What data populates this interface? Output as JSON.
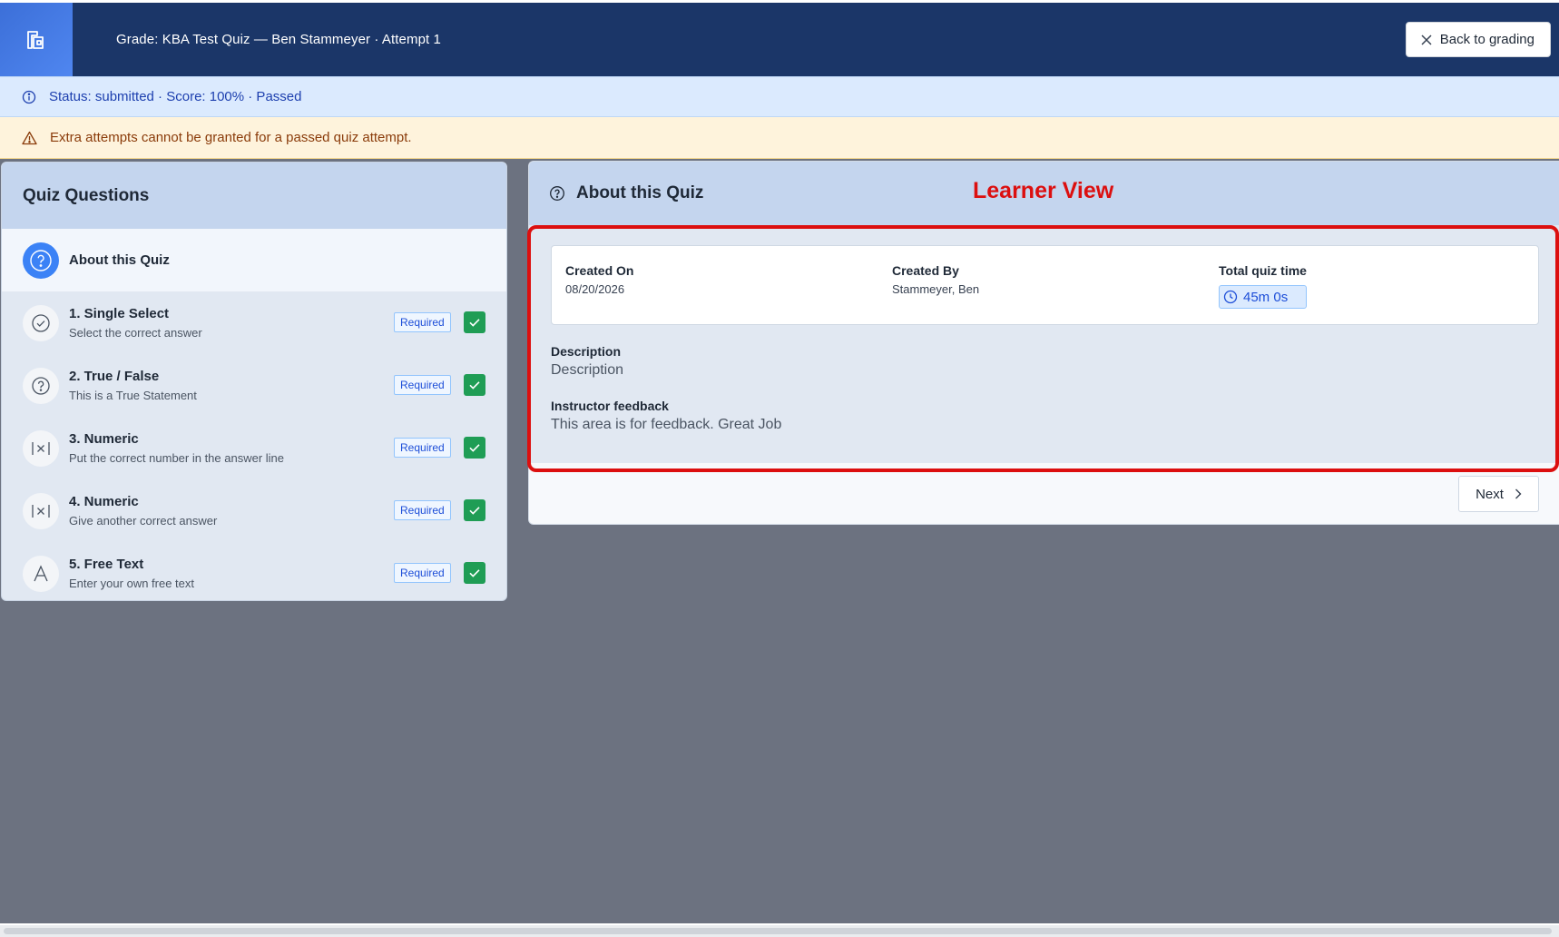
{
  "header": {
    "title": "Grade: KBA Test Quiz — Ben Stammeyer · Attempt 1",
    "back_label": "Back to grading"
  },
  "status": {
    "text": "Status: submitted · Score: 100% · Passed"
  },
  "warning": {
    "text": "Extra attempts cannot be granted for a passed quiz attempt."
  },
  "sidebar": {
    "title": "Quiz Questions",
    "about_label": "About this Quiz",
    "required_label": "Required",
    "questions": [
      {
        "title": "1. Single Select",
        "subtitle": "Select the correct answer",
        "icon": "check-circle-icon"
      },
      {
        "title": "2. True / False",
        "subtitle": "This is a True Statement",
        "icon": "question-circle-icon"
      },
      {
        "title": "3. Numeric",
        "subtitle": "Put the correct number in the answer line",
        "icon": "numeric-icon"
      },
      {
        "title": "4. Numeric",
        "subtitle": "Give another correct answer",
        "icon": "numeric-icon"
      },
      {
        "title": "5. Free Text",
        "subtitle": "Enter your own free text",
        "icon": "text-icon"
      }
    ]
  },
  "main": {
    "title": "About this Quiz",
    "annotation": "Learner View",
    "created_on_label": "Created On",
    "created_on_value": "08/20/2026",
    "created_by_label": "Created By",
    "created_by_value": "Stammeyer, Ben",
    "total_time_label": "Total quiz time",
    "total_time_value": "45m 0s",
    "description_label": "Description",
    "description_value": "Description",
    "feedback_label": "Instructor feedback",
    "feedback_value": "This area is for feedback. Great Job",
    "next_label": "Next"
  },
  "colors": {
    "header_bg": "#1b3668",
    "accent_blue": "#3b82f6",
    "success_green": "#1f9d55",
    "annotation_red": "#dc0f0f"
  }
}
